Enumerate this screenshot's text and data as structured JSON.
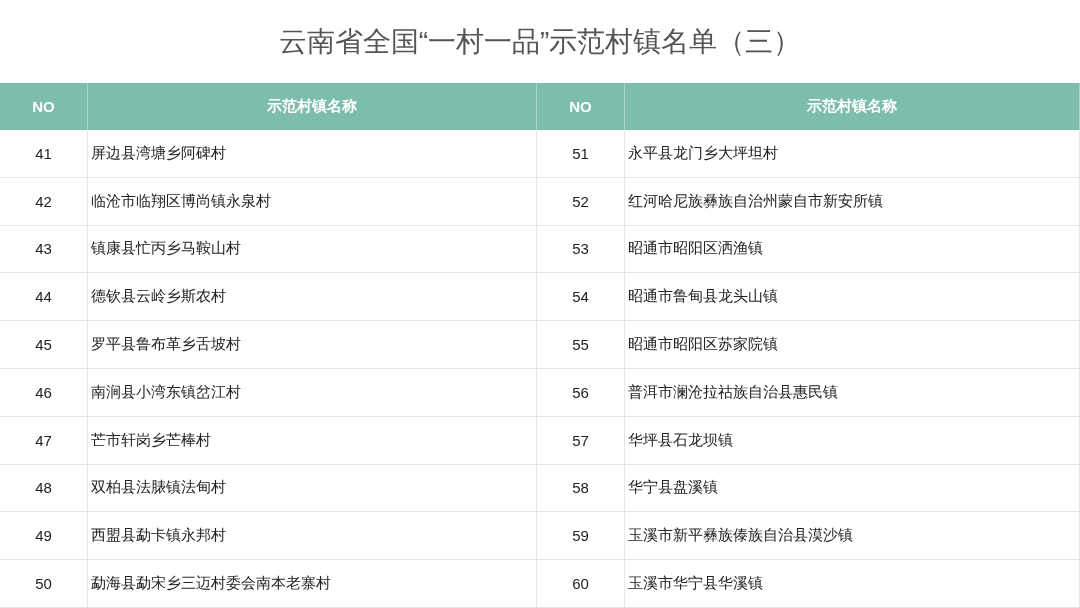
{
  "title": "云南省全国“一村一品”示范村镇名单（三）",
  "table": {
    "columns": [
      "NO",
      "示范村镇名称",
      "NO",
      "示范村镇名称"
    ],
    "rows": [
      [
        "41",
        "屏边县湾塘乡阿碑村",
        "51",
        "永平县龙门乡大坪坦村"
      ],
      [
        "42",
        "临沧市临翔区博尚镇永泉村",
        "52",
        "红河哈尼族彝族自治州蒙自市新安所镇"
      ],
      [
        "43",
        "镇康县忙丙乡马鞍山村",
        "53",
        "昭通市昭阳区洒渔镇"
      ],
      [
        "44",
        "德钦县云岭乡斯农村",
        "54",
        "昭通市鲁甸县龙头山镇"
      ],
      [
        "45",
        "罗平县鲁布革乡舌坡村",
        "55",
        "昭通市昭阳区苏家院镇"
      ],
      [
        "46",
        "南涧县小湾东镇岔江村",
        "56",
        "普洱市澜沧拉祜族自治县惠民镇"
      ],
      [
        "47",
        "芒市轩岗乡芒棒村",
        "57",
        "华坪县石龙坝镇"
      ],
      [
        "48",
        "双柏县法脿镇法甸村",
        "58",
        "华宁县盘溪镇"
      ],
      [
        "49",
        "西盟县勐卡镇永邦村",
        "59",
        "玉溪市新平彝族傣族自治县漠沙镇"
      ],
      [
        "50",
        "勐海县勐宋乡三迈村委会南本老寨村",
        "60",
        "玉溪市华宁县华溪镇"
      ]
    ]
  }
}
